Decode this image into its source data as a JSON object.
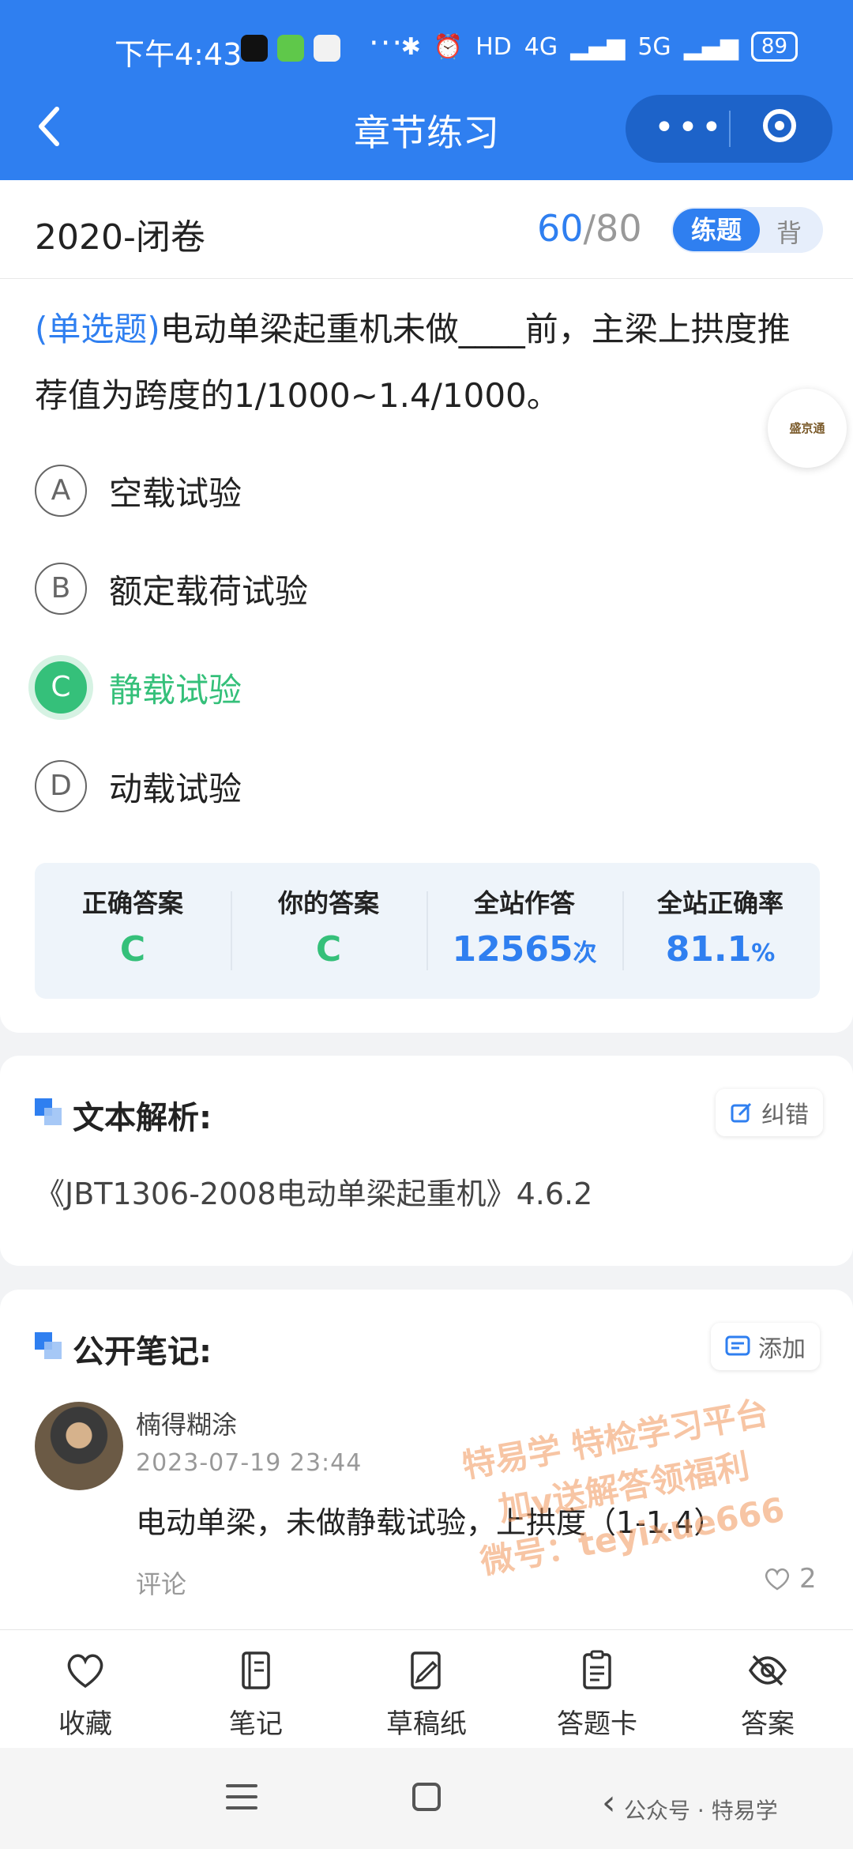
{
  "status_bar": {
    "time": "下午4:43",
    "more": "···",
    "network_4g": "4G",
    "network_5g": "5G",
    "hd": "HD",
    "battery": "89"
  },
  "title_bar": {
    "title": "章节练习"
  },
  "header": {
    "paper": "2020-闭卷",
    "current": "60",
    "separator": "/",
    "total": "80",
    "mode_active": "练题",
    "mode_inactive": "背"
  },
  "question": {
    "type": "(单选题)",
    "text": "电动单梁起重机未做____前，主梁上拱度推荐值为跨度的1/1000~1.4/1000。",
    "float_logo": "盛京通",
    "options": [
      {
        "letter": "A",
        "text": "空载试验"
      },
      {
        "letter": "B",
        "text": "额定载荷试验"
      },
      {
        "letter": "C",
        "text": "静载试验"
      },
      {
        "letter": "D",
        "text": "动载试验"
      }
    ],
    "stats": {
      "correct_label": "正确答案",
      "correct_value": "C",
      "yours_label": "你的答案",
      "yours_value": "C",
      "site_label": "全站作答",
      "site_value": "12565",
      "site_unit": "次",
      "rate_label": "全站正确率",
      "rate_value": "81.1",
      "rate_unit": "%"
    }
  },
  "analysis": {
    "title": "文本解析:",
    "report_label": "纠错",
    "text": "《JBT1306-2008电动单梁起重机》4.6.2"
  },
  "notes": {
    "title": "公开笔记:",
    "add_label": "添加",
    "items": [
      {
        "user": "楠得糊涂",
        "time": "2023-07-19 23:44",
        "body": "电动单梁，未做静载试验，上拱度（1-1.4）",
        "comment_label": "评论",
        "likes": "2"
      }
    ],
    "watermark": [
      "特易学 特检学习平台",
      "加v送解答领福利",
      "微号：teyixue666"
    ]
  },
  "toolbar": {
    "items": [
      {
        "label": "收藏",
        "icon": "heart-icon"
      },
      {
        "label": "笔记",
        "icon": "notebook-icon"
      },
      {
        "label": "草稿纸",
        "icon": "draft-icon"
      },
      {
        "label": "答题卡",
        "icon": "answer-card-icon"
      },
      {
        "label": "答案",
        "icon": "eye-slash-icon"
      }
    ]
  },
  "system_nav": {
    "wechat": "公众号 · 特易学"
  },
  "colors": {
    "primary": "#2f7ff0",
    "correct": "#35c07a"
  }
}
